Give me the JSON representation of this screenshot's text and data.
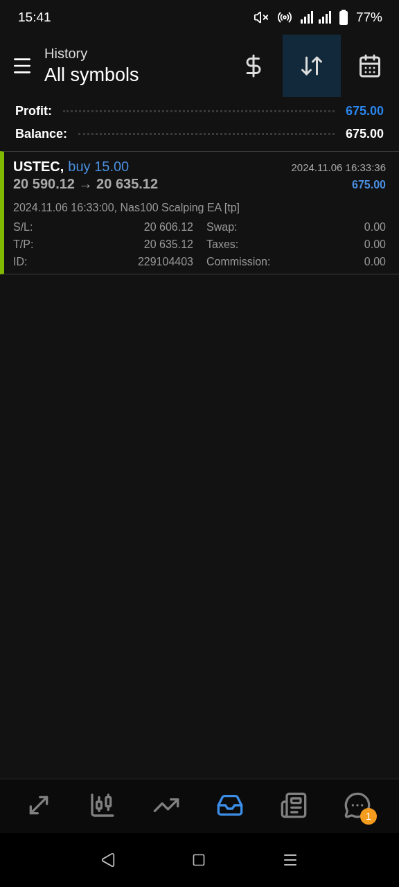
{
  "status_bar": {
    "time": "15:41",
    "battery": "77%"
  },
  "toolbar": {
    "subtitle": "History",
    "title": "All symbols",
    "actions": [
      {
        "kind": "currency",
        "selected": false
      },
      {
        "kind": "sort",
        "selected": true
      },
      {
        "kind": "calendar",
        "selected": false
      }
    ]
  },
  "summary": [
    {
      "label": "Profit:",
      "value": "675.00",
      "kind": "profit"
    },
    {
      "label": "Balance:",
      "value": "675.00",
      "kind": "plain"
    }
  ],
  "deals": [
    {
      "symbol": "USTEC,",
      "side": "buy 15.00",
      "prices": "20 590.12 → 20 635.12",
      "time": "2024.11.06 16:33:36",
      "profit": "675.00",
      "comment": "2024.11.06 16:33:00, Nas100 Scalping EA [tp]",
      "fields": [
        {
          "label": "S/L:",
          "value": "20 606.12"
        },
        {
          "label": "Swap:",
          "value": "0.00"
        },
        {
          "label": "T/P:",
          "value": "20 635.12"
        },
        {
          "label": "Taxes:",
          "value": "0.00"
        },
        {
          "label": "ID:",
          "value": "229104403"
        },
        {
          "label": "Commission:",
          "value": "0.00"
        }
      ]
    }
  ],
  "bottom_nav": [
    {
      "kind": "trade",
      "selected": false
    },
    {
      "kind": "chart",
      "selected": false
    },
    {
      "kind": "trend",
      "selected": false
    },
    {
      "kind": "history",
      "selected": true
    },
    {
      "kind": "news",
      "selected": false
    },
    {
      "kind": "chat",
      "selected": false,
      "badge": "1"
    }
  ]
}
